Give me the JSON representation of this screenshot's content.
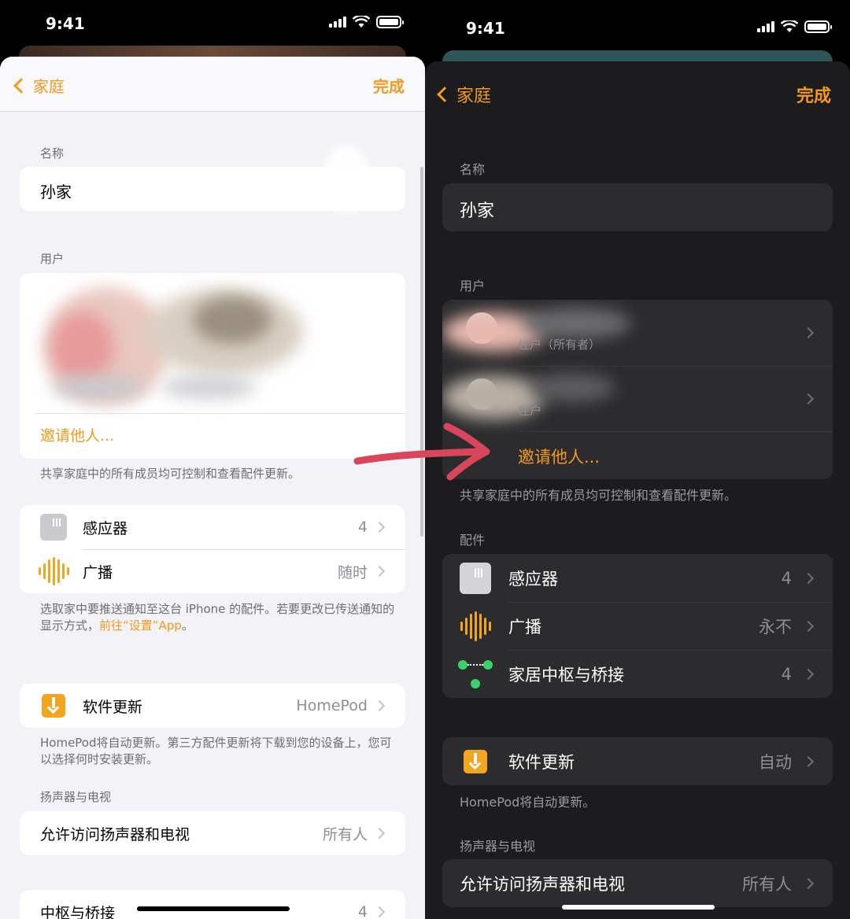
{
  "status_bar": {
    "time": "9:41"
  },
  "light": {
    "nav": {
      "back_label": "家庭",
      "done_label": "完成"
    },
    "name_section": {
      "label": "名称",
      "value": "孙家"
    },
    "users_section": {
      "label": "用户",
      "invite_label": "邀请他人...",
      "footer": "共享家庭中的所有成员均可控制和查看配件更新。"
    },
    "accessories": [
      {
        "icon": "sensor-icon",
        "label": "感应器",
        "value": "4"
      },
      {
        "icon": "broadcast-waveform-icon",
        "label": "广播",
        "value": "随时"
      }
    ],
    "accessories_footer_pre": "选取家中要推送通知至这台 iPhone 的配件。若要更改已传送通知的显示方式，",
    "accessories_footer_link": "前往“设置”App",
    "accessories_footer_post": "。",
    "software_update": {
      "icon": "download-icon",
      "label": "软件更新",
      "value": "HomePod"
    },
    "software_update_footer": "HomePod将自动更新。第三方配件更新将下载到您的设备上，您可以选择何时安装更新。",
    "speakers_section": {
      "label": "扬声器与电视",
      "row_label": "允许访问扬声器和电视",
      "row_value": "所有人"
    },
    "hub_row": {
      "label": "中枢与桥接",
      "value": "4"
    }
  },
  "dark": {
    "nav": {
      "back_label": "家庭",
      "done_label": "完成"
    },
    "name_section": {
      "label": "名称",
      "value": "孙家"
    },
    "users_section": {
      "label": "用户",
      "user1_sub": "住户（所有者）",
      "user2_sub": "住户",
      "invite_label": "邀请他人...",
      "footer": "共享家庭中的所有成员均可控制和查看配件更新。"
    },
    "accessories_label": "配件",
    "accessories": [
      {
        "icon": "sensor-icon",
        "label": "感应器",
        "value": "4"
      },
      {
        "icon": "broadcast-waveform-icon",
        "label": "广播",
        "value": "永不"
      },
      {
        "icon": "hub-bridge-icon",
        "label": "家居中枢与桥接",
        "value": "4"
      }
    ],
    "software_update": {
      "icon": "download-icon",
      "label": "软件更新",
      "value": "自动"
    },
    "software_update_footer": "HomePod将自动更新。",
    "speakers_section": {
      "label": "扬声器与电视",
      "row_label": "允许访问扬声器和电视",
      "row_value": "所有人"
    }
  },
  "colors": {
    "accent": "#f29a1f",
    "arrow": "#d9455a",
    "light_bg": "#f2f2f7",
    "dark_bg": "#1c1c1e"
  }
}
